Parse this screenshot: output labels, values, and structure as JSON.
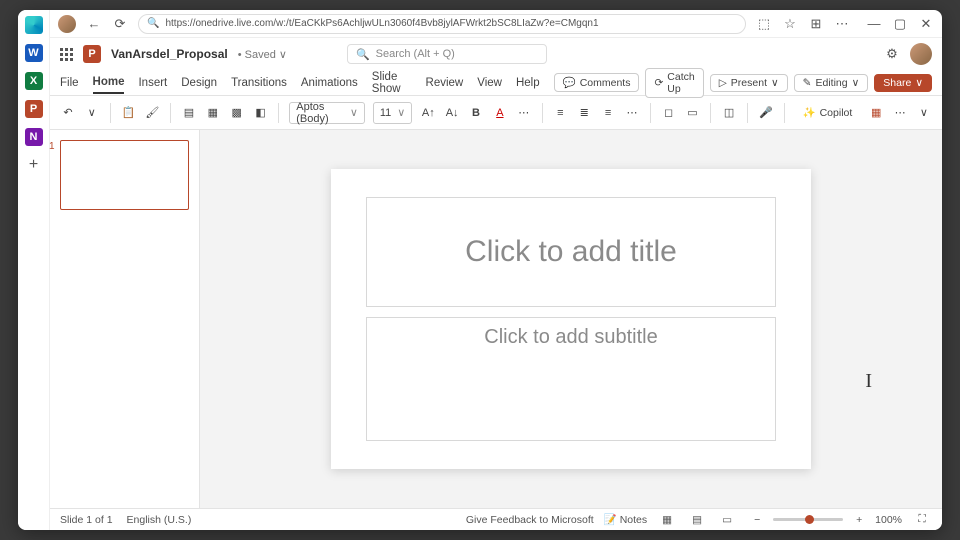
{
  "browser": {
    "url": "https://onedrive.live.com/w:/t/EaCKkPs6AchljwULn3060f4Bvb8jylAFWrkt2bSC8LIaZw?e=CMgqn1"
  },
  "rail": {
    "apps": [
      {
        "label": "",
        "color": "transparent"
      },
      {
        "label": "W",
        "color": "#185abd"
      },
      {
        "label": "X",
        "color": "#107c41"
      },
      {
        "label": "P",
        "color": "#b7472a"
      },
      {
        "label": "N",
        "color": "#7719aa"
      }
    ]
  },
  "header": {
    "doc_name": "VanArsdel_Proposal",
    "saved": "• Saved ∨",
    "search_placeholder": "Search (Alt + Q)"
  },
  "tabs": {
    "items": [
      "File",
      "Home",
      "Insert",
      "Design",
      "Transitions",
      "Animations",
      "Slide Show",
      "Review",
      "View",
      "Help"
    ],
    "active": 1,
    "buttons": {
      "comments": "Comments",
      "catchup": "Catch Up",
      "present": "Present",
      "editing": "Editing",
      "share": "Share"
    }
  },
  "ribbon": {
    "font": "Aptos (Body)",
    "size": "11",
    "copilot": "Copilot"
  },
  "slide": {
    "title_placeholder": "Click to add title",
    "subtitle_placeholder": "Click to add subtitle",
    "thumb_number": "1"
  },
  "status": {
    "slide": "Slide 1 of 1",
    "lang": "English (U.S.)",
    "feedback": "Give Feedback to Microsoft",
    "notes": "Notes",
    "zoom": "100%"
  }
}
